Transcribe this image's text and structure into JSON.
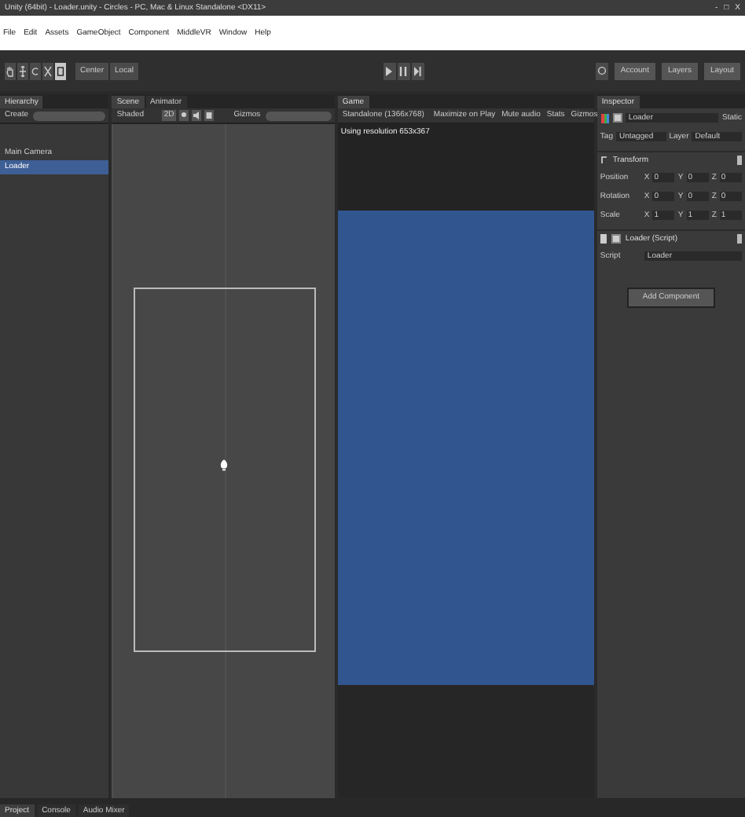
{
  "window": {
    "title": "Unity (64bit) - Loader.unity - Circles - PC, Mac & Linux Standalone <DX11>",
    "controls": [
      "-",
      "□",
      "X"
    ]
  },
  "menu": [
    "File",
    "Edit",
    "Assets",
    "GameObject",
    "Component",
    "MiddleVR",
    "Window",
    "Help"
  ],
  "toolbar": {
    "tools": [
      {
        "kind": "hand",
        "selected": false
      },
      {
        "kind": "move",
        "selected": false
      },
      {
        "kind": "rotate",
        "selected": false
      },
      {
        "kind": "scale",
        "selected": false
      },
      {
        "kind": "rect",
        "selected": true
      }
    ],
    "pivot": [
      "Center",
      "Local"
    ],
    "account": "Account",
    "layers": "Layers",
    "layout": "Layout"
  },
  "hierarchy": {
    "tab": "Hierarchy",
    "create": "Create",
    "items": [
      {
        "label": "Main Camera",
        "selected": false
      },
      {
        "label": "Loader",
        "selected": true
      }
    ]
  },
  "scene": {
    "tabs": [
      {
        "label": "Scene",
        "selected": true
      },
      {
        "label": "Animator",
        "selected": false
      }
    ],
    "shading": "Shaded",
    "mode": "2D",
    "gizmos": "Gizmos"
  },
  "game": {
    "tab": "Game",
    "resolution": "Standalone (1366x768)",
    "toggles": [
      "Maximize on Play",
      "Mute audio",
      "Stats"
    ],
    "gizmos": "Gizmos",
    "message": "Using resolution 653x367"
  },
  "inspector": {
    "tab": "Inspector",
    "object": "Loader",
    "active": true,
    "static_label": "Static",
    "tag_label": "Tag",
    "tag": "Untagged",
    "layer_label": "Layer",
    "layer": "Default",
    "transform": {
      "title": "Transform",
      "rows": [
        {
          "label": "Position",
          "fields": [
            {
              "axis": "X",
              "value": "0"
            },
            {
              "axis": "Y",
              "value": "0"
            },
            {
              "axis": "Z",
              "value": "0"
            }
          ]
        },
        {
          "label": "Rotation",
          "fields": [
            {
              "axis": "X",
              "value": "0"
            },
            {
              "axis": "Y",
              "value": "0"
            },
            {
              "axis": "Z",
              "value": "0"
            }
          ]
        },
        {
          "label": "Scale",
          "fields": [
            {
              "axis": "X",
              "value": "1"
            },
            {
              "axis": "Y",
              "value": "1"
            },
            {
              "axis": "Z",
              "value": "1"
            }
          ]
        }
      ]
    },
    "script_component": {
      "title": "Loader (Script)",
      "enabled": true,
      "field_label": "Script",
      "value": "Loader"
    },
    "add_button": "Add Component"
  },
  "bottom_tabs": [
    {
      "label": "Project",
      "selected": true
    },
    {
      "label": "Console",
      "selected": false
    },
    {
      "label": "Audio Mixer",
      "selected": false
    }
  ]
}
